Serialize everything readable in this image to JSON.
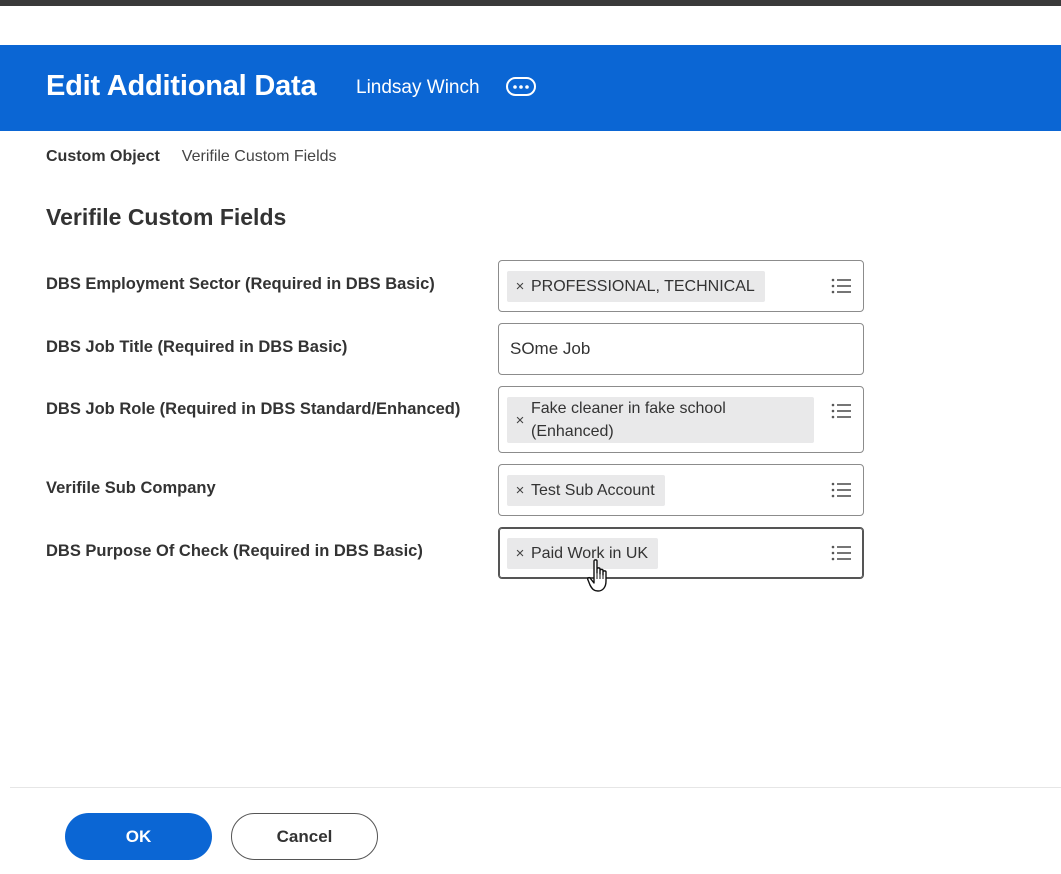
{
  "header": {
    "title": "Edit Additional Data",
    "worker_name": "Lindsay Winch",
    "related_actions_icon": "ellipsis-icon",
    "background_color": "#0b66d4"
  },
  "breadcrumb": {
    "object_label": "Custom Object",
    "object_value": "Verifile Custom Fields"
  },
  "section_title": "Verifile Custom Fields",
  "fields": [
    {
      "label": "DBS Employment Sector (Required in DBS Basic)",
      "type": "prompt",
      "selected": [
        "PROFESSIONAL, TECHNICAL"
      ]
    },
    {
      "label": "DBS Job Title (Required in DBS Basic)",
      "type": "text",
      "value": "SOme Job"
    },
    {
      "label": "DBS Job Role (Required in DBS Standard/Enhanced)",
      "type": "prompt",
      "selected": [
        "Fake cleaner in fake school (Enhanced)"
      ],
      "selected_lines": [
        "Fake cleaner in fake school",
        "(Enhanced)"
      ]
    },
    {
      "label": "Verifile Sub Company",
      "type": "prompt",
      "selected": [
        "Test Sub Account"
      ]
    },
    {
      "label": "DBS Purpose Of Check (Required in DBS Basic)",
      "type": "prompt",
      "selected": [
        "Paid Work in UK"
      ],
      "focused": true
    }
  ],
  "icons": {
    "remove": "×",
    "prompt_list": "list-icon",
    "cursor": "hand-pointer-icon"
  },
  "footer": {
    "ok_label": "OK",
    "cancel_label": "Cancel",
    "primary_color": "#0b66d4"
  }
}
